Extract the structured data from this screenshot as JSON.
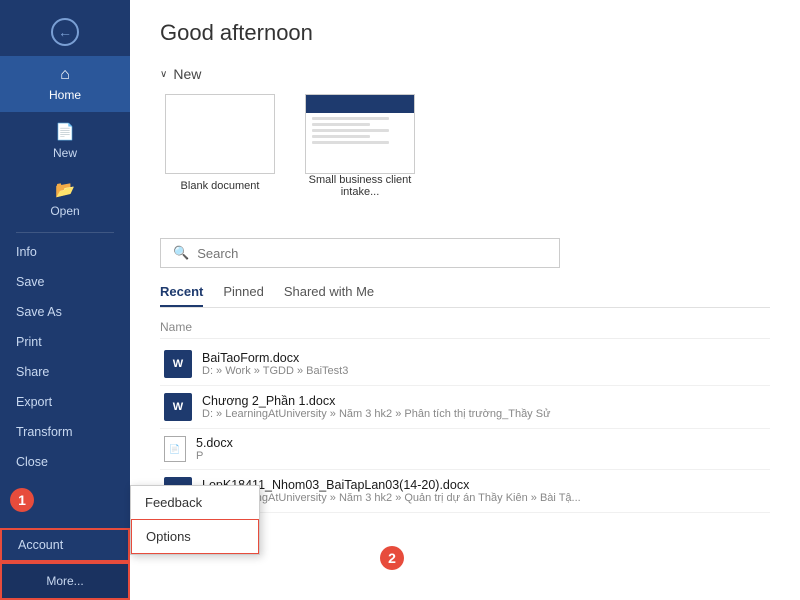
{
  "sidebar": {
    "back_label": "←",
    "home_label": "Home",
    "new_label": "New",
    "open_label": "Open",
    "info_label": "Info",
    "save_label": "Save",
    "saveas_label": "Save As",
    "print_label": "Print",
    "share_label": "Share",
    "export_label": "Export",
    "transform_label": "Transform",
    "close_label": "Close",
    "account_label": "Account",
    "more_label": "More..."
  },
  "main": {
    "greeting": "Good afternoon",
    "new_section_label": "New",
    "templates": [
      {
        "label": "Blank document",
        "type": "blank"
      },
      {
        "label": "Small business client intake...",
        "type": "template"
      }
    ],
    "search_placeholder": "Search",
    "tabs": [
      {
        "label": "Recent",
        "active": true
      },
      {
        "label": "Pinned",
        "active": false
      },
      {
        "label": "Shared with Me",
        "active": false
      }
    ],
    "files_header": "Name",
    "files": [
      {
        "name": "BaiTaoForm.docx",
        "path": "D: » Work » TGDD » BaiTest3",
        "type": "word"
      },
      {
        "name": "Chương 2_Phần 1.docx",
        "path": "D: » LearningAtUniversity » Năm 3 hk2 » Phân tích thị trường_Thầy Sử",
        "type": "word"
      },
      {
        "name": "5.docx",
        "path": "P",
        "type": "word"
      },
      {
        "name": "LopK18411_Nhom03_BaiTapLan03(14-20).docx",
        "path": "D: » LearningAtUniversity » Năm 3 hk2 » Quản trị dự án Thầy Kiên » Bài Tậ...",
        "type": "word"
      }
    ]
  },
  "popup": {
    "feedback_label": "Feedback",
    "options_label": "Options"
  },
  "annotations": {
    "num1": "1",
    "num2": "2"
  }
}
